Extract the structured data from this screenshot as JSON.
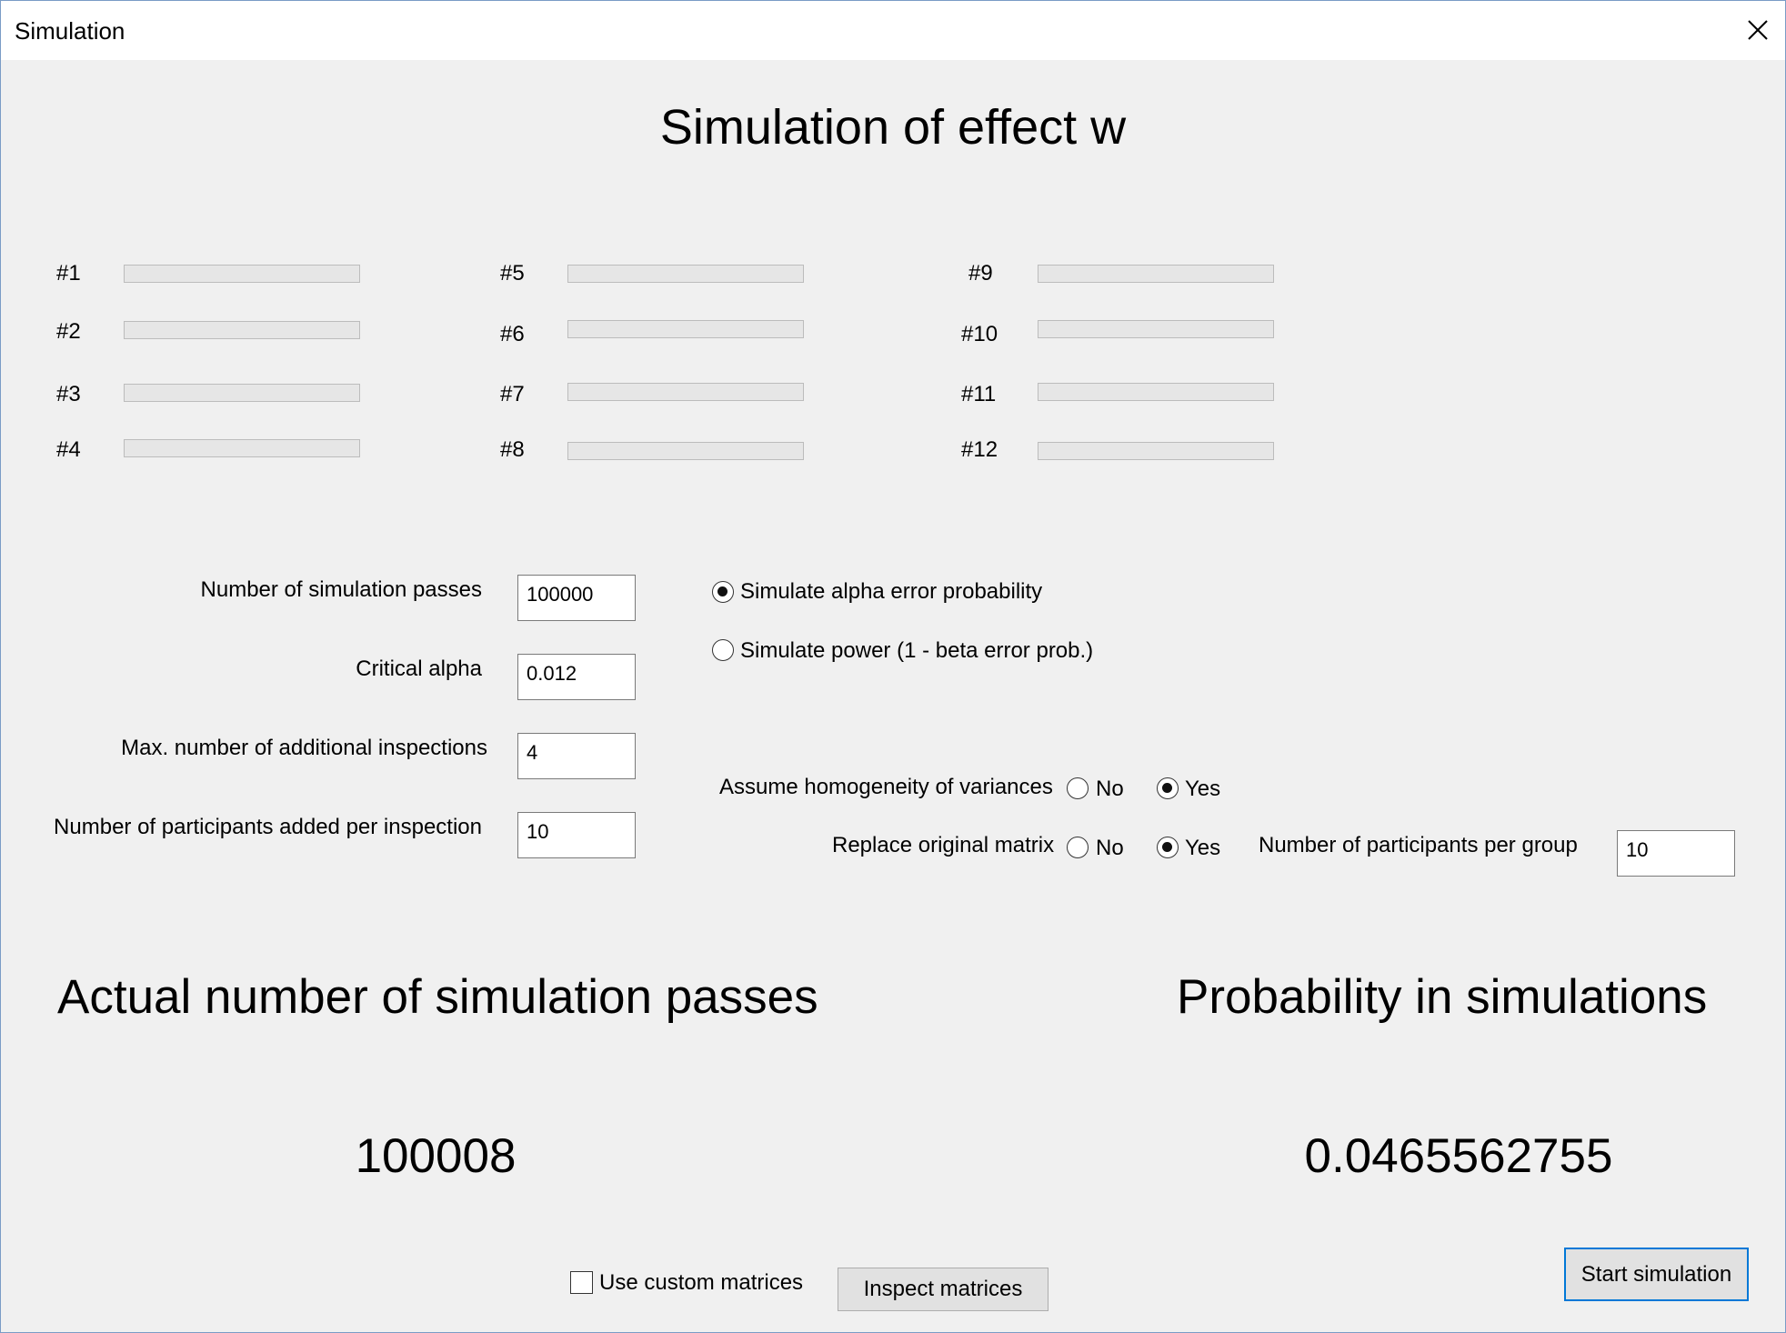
{
  "window": {
    "title": "Simulation"
  },
  "heading": "Simulation of effect w",
  "progress": {
    "items": [
      {
        "label": "#1",
        "fraction": 0
      },
      {
        "label": "#2",
        "fraction": 0
      },
      {
        "label": "#3",
        "fraction": 0
      },
      {
        "label": "#4",
        "fraction": 0
      },
      {
        "label": "#5",
        "fraction": 0
      },
      {
        "label": "#6",
        "fraction": 0
      },
      {
        "label": "#7",
        "fraction": 0
      },
      {
        "label": "#8",
        "fraction": 0
      },
      {
        "label": "#9",
        "fraction": 0
      },
      {
        "label": "#10",
        "fraction": 0
      },
      {
        "label": "#11",
        "fraction": 0
      },
      {
        "label": "#12",
        "fraction": 0
      }
    ]
  },
  "params": {
    "passes_label": "Number of simulation passes",
    "passes_value": "100000",
    "alpha_label": "Critical alpha",
    "alpha_value": "0.012",
    "inspections_label": "Max. number of additional inspections",
    "inspections_value": "4",
    "added_label": "Number of participants added per inspection",
    "added_value": "10"
  },
  "mode": {
    "alpha_label": "Simulate alpha error probability",
    "power_label": "Simulate power (1 - beta error prob.)",
    "selected": "alpha"
  },
  "homogeneity": {
    "label": "Assume homogeneity of variances",
    "no": "No",
    "yes": "Yes",
    "selected": "yes"
  },
  "replace": {
    "label": "Replace original matrix",
    "no": "No",
    "yes": "Yes",
    "selected": "yes"
  },
  "per_group": {
    "label": "Number of participants per group",
    "value": "10"
  },
  "results": {
    "actual_label": "Actual number of simulation passes",
    "actual_value": "100008",
    "prob_label": "Probability in simulations",
    "prob_value": "0.0465562755"
  },
  "footer": {
    "custom_label": "Use custom matrices",
    "custom_checked": false,
    "inspect_button": "Inspect matrices",
    "start_button": "Start simulation"
  },
  "icons": {
    "close": "close-icon"
  }
}
